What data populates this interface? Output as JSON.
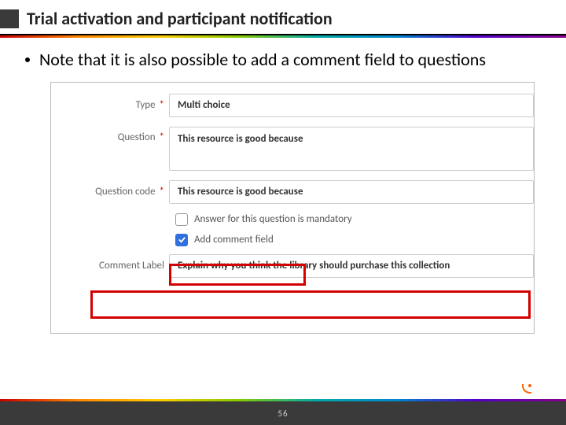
{
  "title": "Trial activation and participant notification",
  "bullet": "Note that it is also possible to add a comment field to questions",
  "form": {
    "type_label": "Type",
    "type_value": "Multi choice",
    "question_label": "Question",
    "question_value": "This resource is good because",
    "code_label": "Question code",
    "code_value": "This resource is good because",
    "mandatory_label": "Answer for this question is mandatory",
    "add_comment_label": "Add comment field",
    "comment_label_caption": "Comment Label",
    "comment_label_value": "Explain why you think the library should purchase this collection"
  },
  "required_marker": "*",
  "page_number": "56"
}
